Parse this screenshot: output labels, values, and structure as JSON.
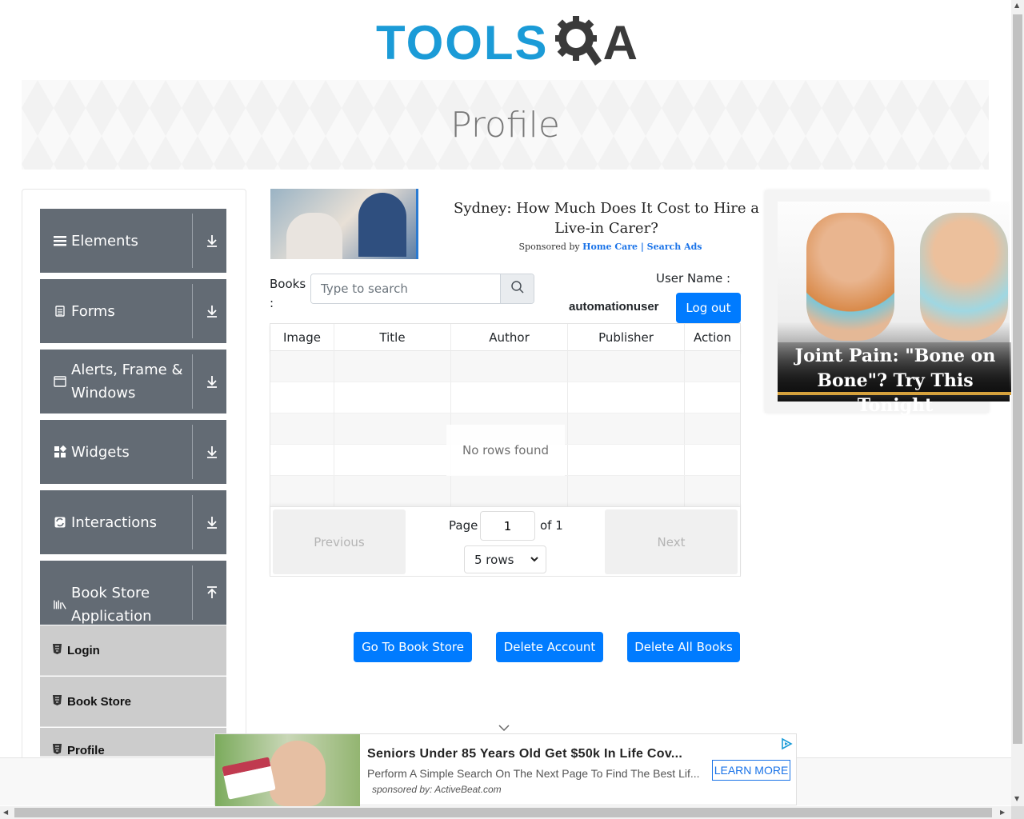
{
  "brand": {
    "logo_text": "TOOLS",
    "logo_suffix": "A",
    "colors": {
      "primary": "#1b9bd7",
      "dark": "#3a3a3a"
    }
  },
  "header": {
    "title": "Profile"
  },
  "sidebar": {
    "groups": [
      {
        "label": "Elements",
        "icon": "hamburger-icon",
        "arrow": "download-arrow-icon"
      },
      {
        "label": "Forms",
        "icon": "form-icon",
        "arrow": "download-arrow-icon"
      },
      {
        "label": "Alerts, Frame & Windows",
        "icon": "window-icon",
        "arrow": "download-arrow-icon"
      },
      {
        "label": "Widgets",
        "icon": "widgets-icon",
        "arrow": "download-arrow-icon"
      },
      {
        "label": "Interactions",
        "icon": "interaction-icon",
        "arrow": "download-arrow-icon"
      },
      {
        "label": "Book Store Application",
        "icon": "books-icon",
        "arrow": "upload-arrow-icon"
      }
    ],
    "book_store_items": [
      {
        "label": "Login"
      },
      {
        "label": "Book Store"
      },
      {
        "label": "Profile"
      }
    ]
  },
  "ad_top": {
    "title": "Sydney: How Much Does It Cost to Hire a Live-in Carer?",
    "sponsored_by": "Sponsored by",
    "sponsor_link": "Home Care | Search Ads"
  },
  "ad_right": {
    "caption": "Joint Pain: \"Bone on Bone\"? Try This Tonight"
  },
  "profile": {
    "books_label": "Books :",
    "search_placeholder": "Type to search",
    "username_label": "User Name :",
    "username_value": "automationuser",
    "logout_label": "Log out"
  },
  "table": {
    "columns": [
      "Image",
      "Title",
      "Author",
      "Publisher",
      "Action"
    ],
    "empty_message": "No rows found",
    "pagination": {
      "previous_label": "Previous",
      "next_label": "Next",
      "page_label": "Page",
      "page_value": "1",
      "of_label": "of 1",
      "rows_option": "5 rows"
    }
  },
  "actions": {
    "go_to_store": "Go To Book Store",
    "delete_account": "Delete Account",
    "delete_all_books": "Delete All Books"
  },
  "ad_bottom": {
    "headline": "Seniors Under 85 Years Old Get $50k In Life Cov...",
    "sub": "Perform A Simple Search On The Next Page To Find The Best Lif...",
    "sponsor": "sponsored by: ActiveBeat.com",
    "cta": "LEARN MORE"
  }
}
